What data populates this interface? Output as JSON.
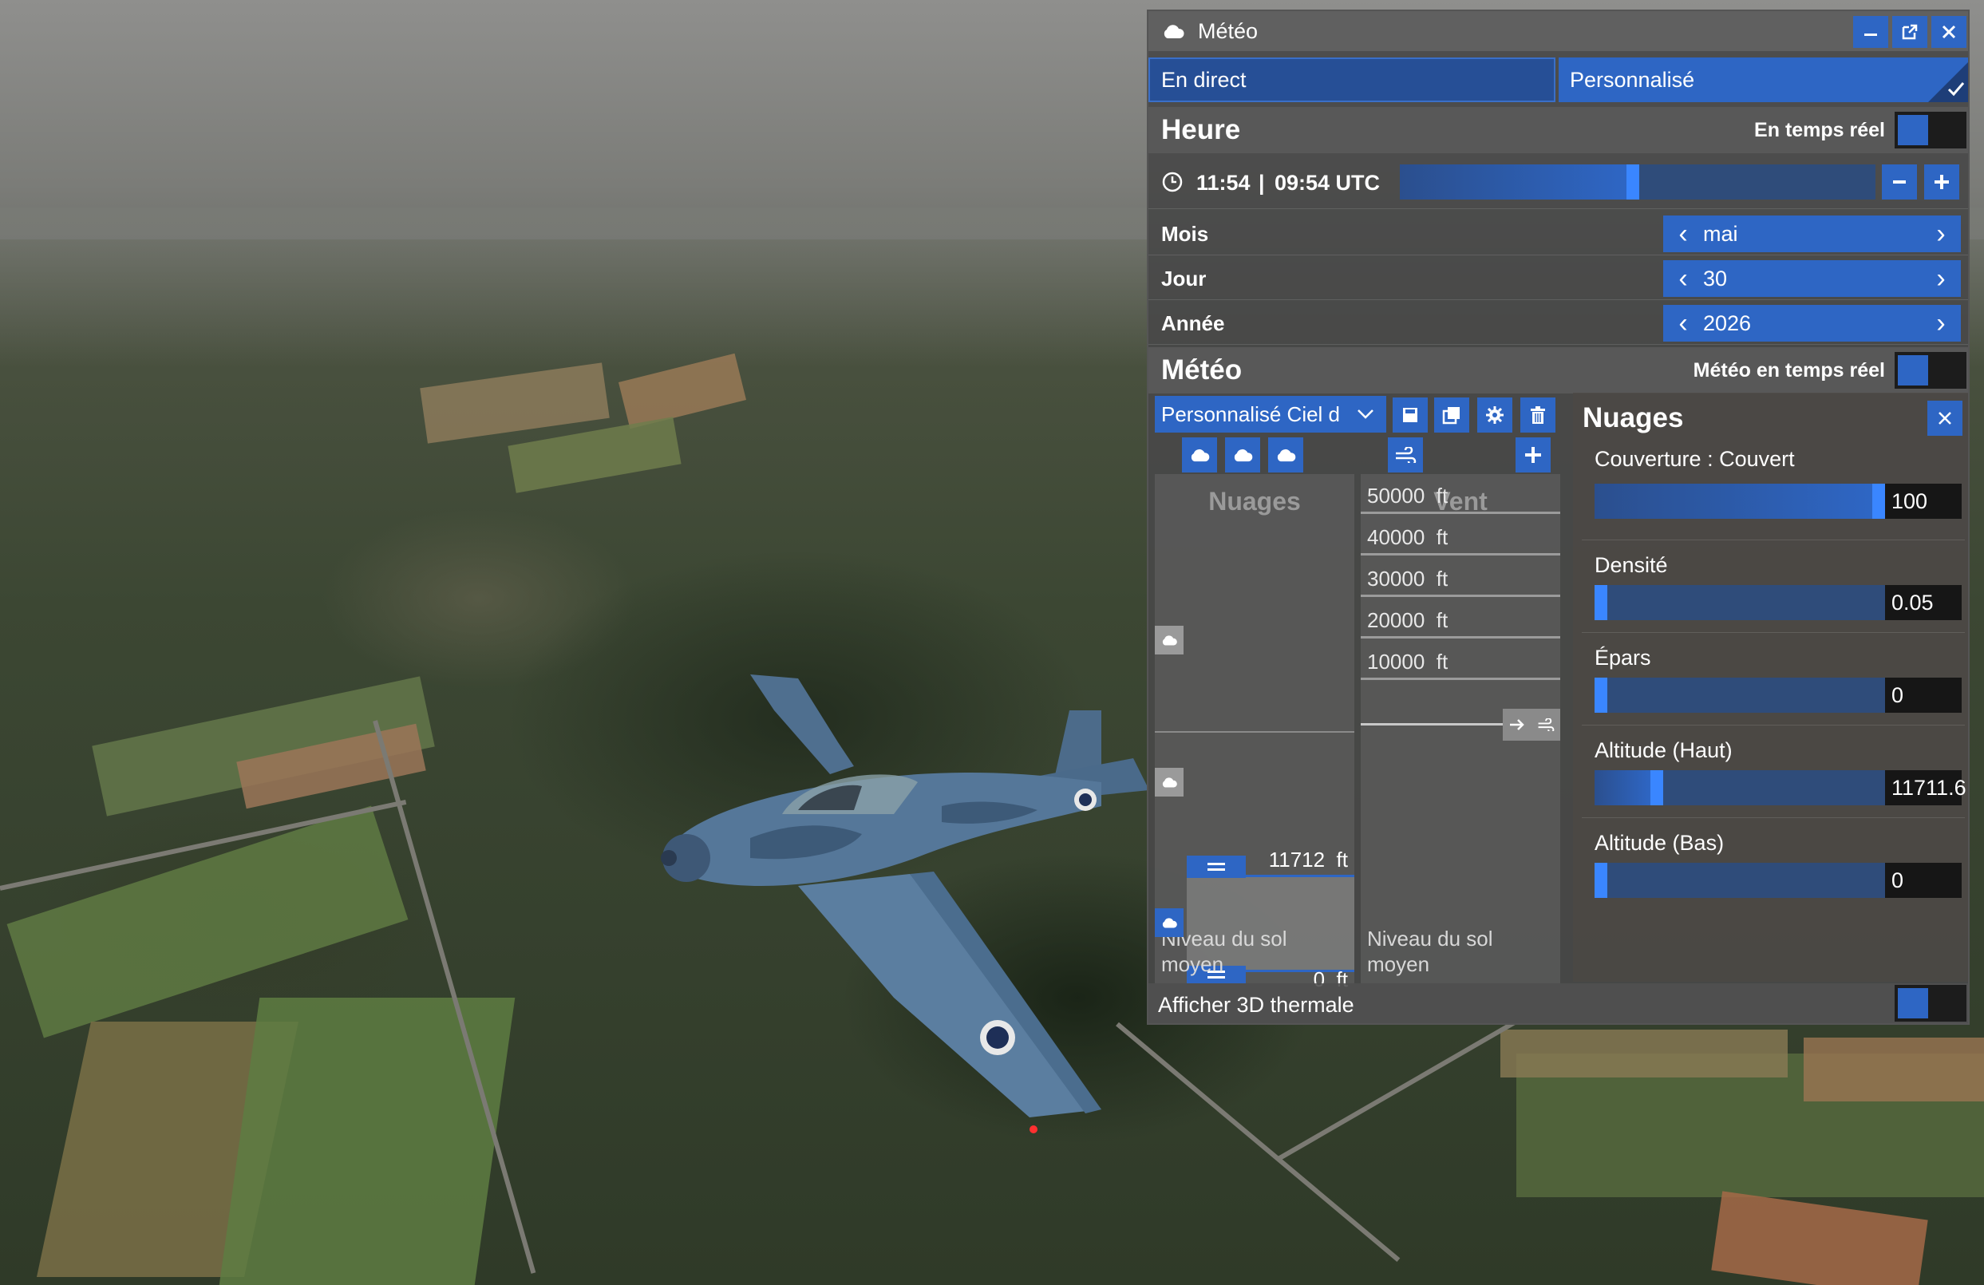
{
  "window": {
    "title": "Météo",
    "icon": "cloud-icon"
  },
  "window_controls": [
    "minimize-icon",
    "popout-icon",
    "close-icon"
  ],
  "mode_tabs": [
    {
      "label": "En direct",
      "selected": false
    },
    {
      "label": "Personnalisé",
      "selected": true
    }
  ],
  "time_section": {
    "heading": "Heure",
    "realtime_label": "En temps réel",
    "realtime_on": false,
    "local_time": "11:54",
    "separator": "|",
    "utc_time": "09:54 UTC",
    "time_slider_fraction": 0.49,
    "rows": [
      {
        "label": "Mois",
        "value": "mai"
      },
      {
        "label": "Jour",
        "value": "30"
      },
      {
        "label": "Année",
        "value": "2026"
      }
    ]
  },
  "weather_section": {
    "heading": "Météo",
    "realtime_label": "Météo en temps réel",
    "realtime_on": false,
    "preset_value": "Personnalisé Ciel d",
    "preset_actions": [
      "save-icon",
      "copy-icon",
      "settings-icon",
      "trash-icon"
    ],
    "layer_tabs": [
      "cloud-layer-1-icon",
      "cloud-layer-2-icon",
      "cloud-layer-3-icon"
    ],
    "wind_tab_icon": "wind-icon",
    "add_icon": "plus-icon",
    "clouds_column_title": "Nuages",
    "wind_column_title": "Vent",
    "altitude_rows": [
      "50000  ft",
      "40000  ft",
      "30000  ft",
      "20000  ft",
      "10000  ft"
    ],
    "top_altitude_label": "11712  ft",
    "bottom_altitude_label": "0  ft",
    "ground_label_clouds": "Niveau du sol moyen",
    "ground_label_wind": "Niveau du sol moyen",
    "thermal_label": "Afficher 3D thermale",
    "thermal_on": false
  },
  "clouds_panel": {
    "title": "Nuages",
    "sliders": [
      {
        "label": "Couverture : Couvert",
        "value": "100",
        "fraction": 1.0
      },
      {
        "label": "Densité",
        "value": "0.05",
        "fraction": 0.0
      },
      {
        "label": "Épars",
        "value": "0",
        "fraction": 0.0
      },
      {
        "label": "Altitude (Haut)",
        "value": "11711.6",
        "fraction": 0.2
      },
      {
        "label": "Altitude (Bas)",
        "value": "0",
        "fraction": 0.0
      }
    ]
  },
  "colors": {
    "accent": "#2e66c4",
    "panel_bg": "#484848",
    "toggle_off": "#1c1c1c"
  }
}
